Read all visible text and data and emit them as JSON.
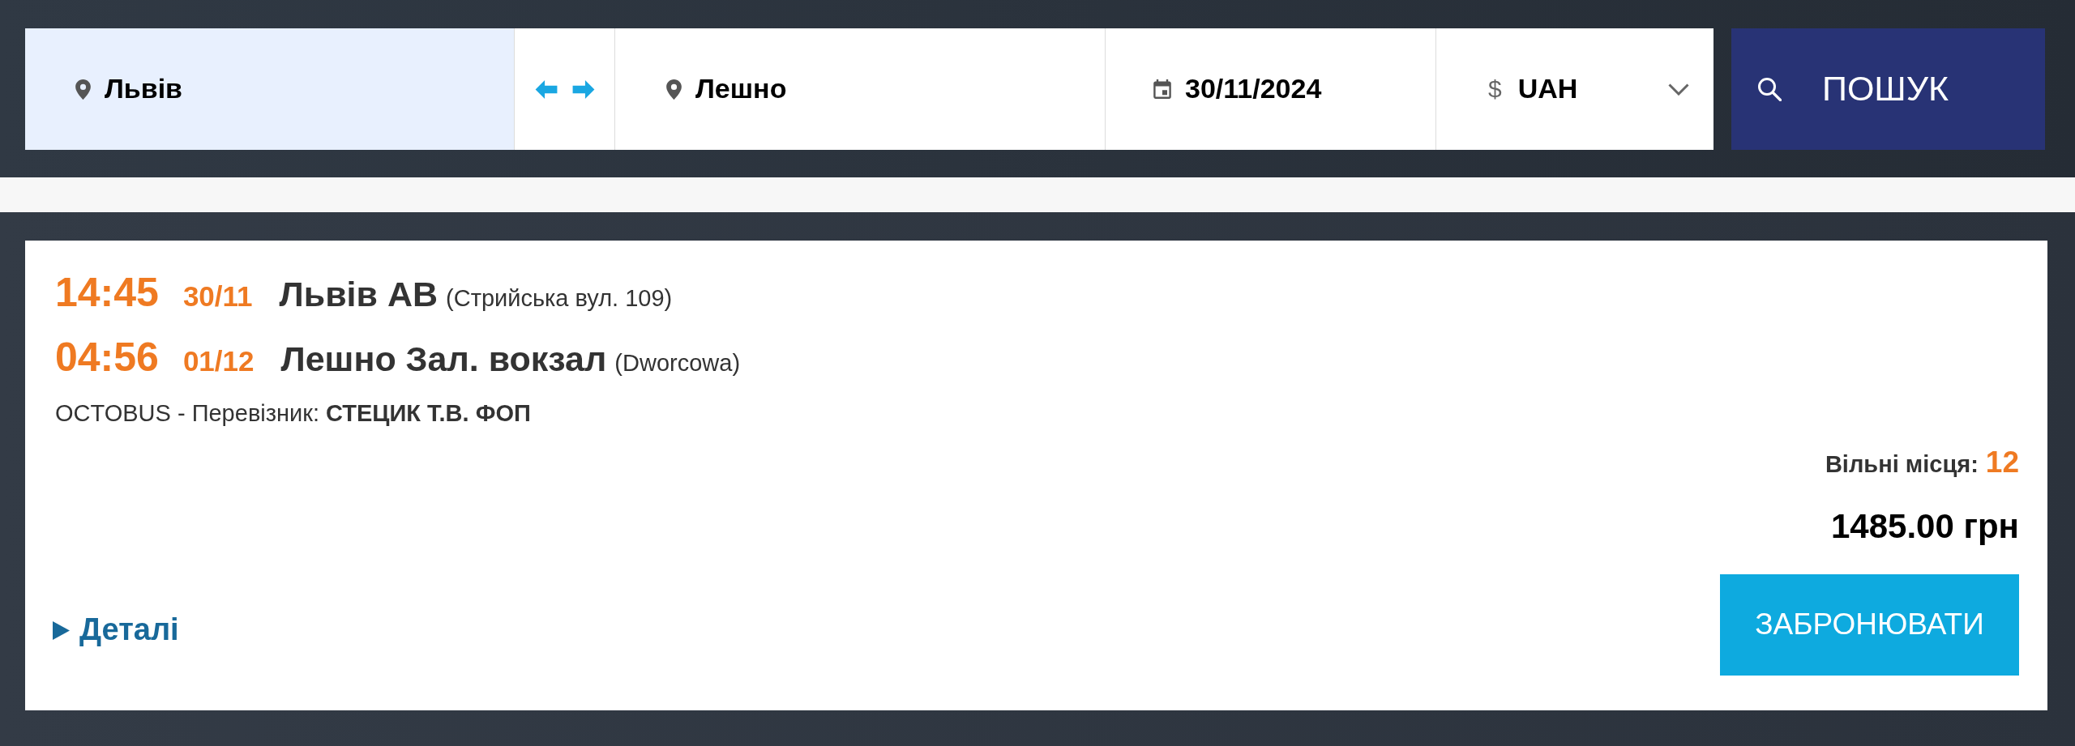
{
  "search": {
    "from": {
      "value": "Львів",
      "highlighted": true
    },
    "to": {
      "value": "Лешно",
      "highlighted": false
    },
    "date": {
      "value": "30/11/2024"
    },
    "currency": {
      "symbol": "$",
      "value": "UAH"
    },
    "search_button": "ПОШУК"
  },
  "results": [
    {
      "departure": {
        "time": "14:45",
        "date": "30/11",
        "station": "Львів АВ",
        "address": "(Стрийська вул. 109)"
      },
      "arrival": {
        "time": "04:56",
        "date": "01/12",
        "station": "Лешно Зал. вокзал",
        "address": "(Dworcowa)"
      },
      "carrier_line": "OCTOBUS - Перевізник: **СТЕЦИК Т.В. ФОП**",
      "seats_label": "Вільні місця:",
      "seats_count": "12",
      "price": "1485.00 грн",
      "details_link": "Деталі",
      "details_expanded": false,
      "book_button": "ЗАБРОНЮВАТИ"
    }
  ]
}
